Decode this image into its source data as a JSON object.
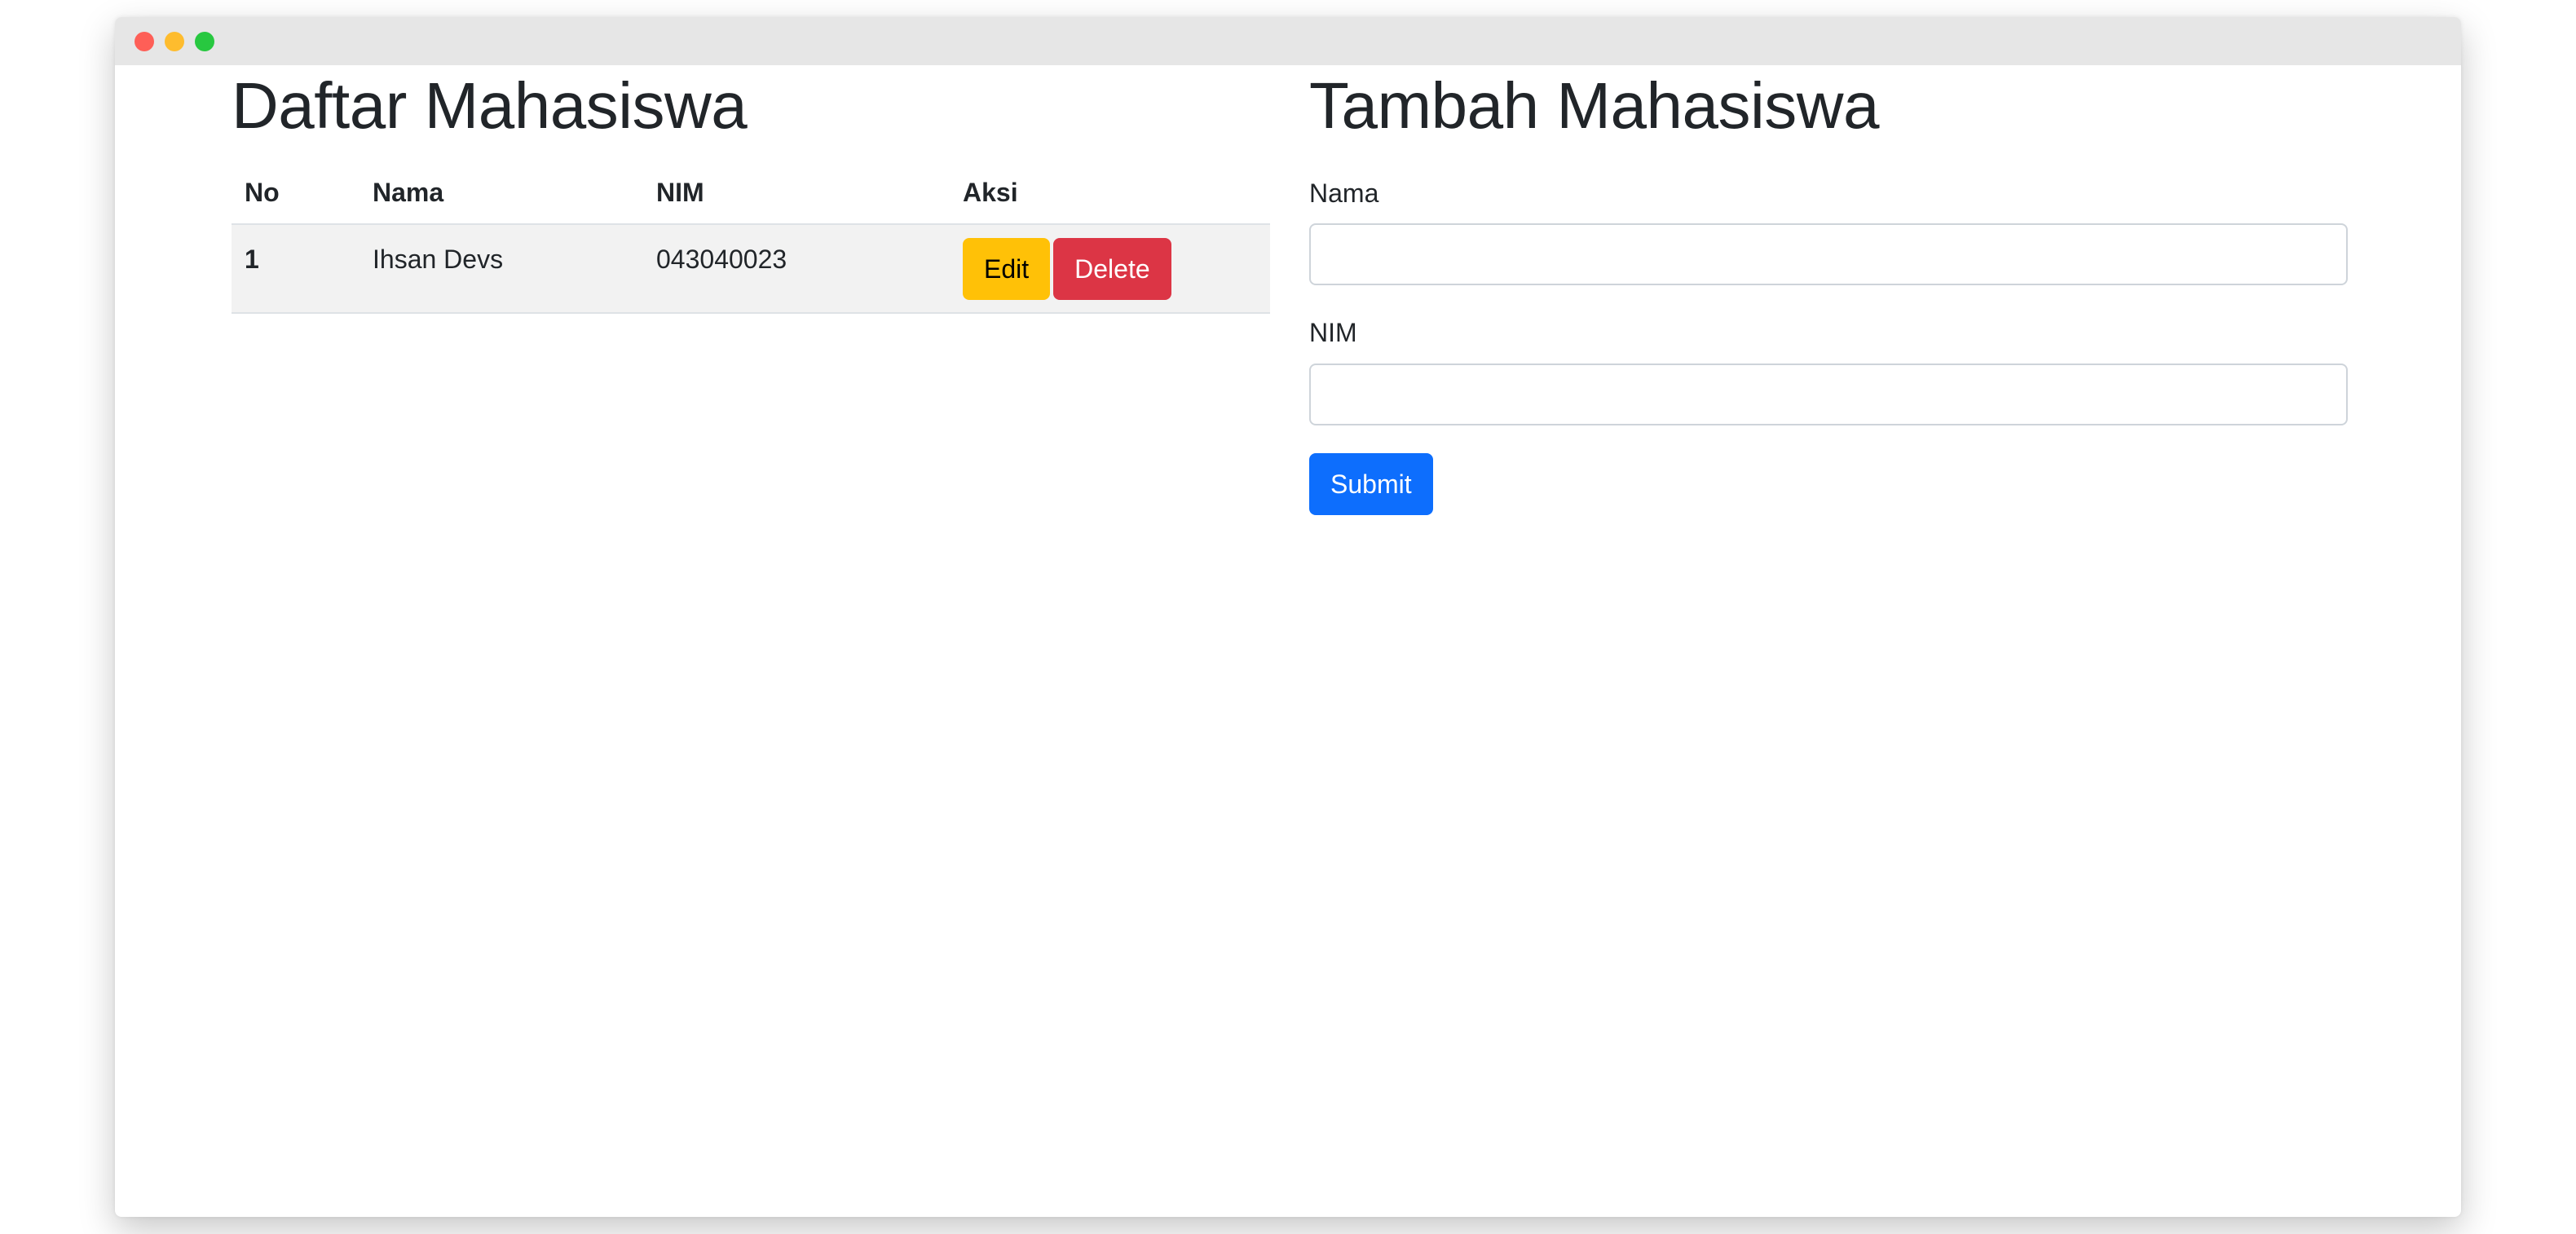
{
  "daftar": {
    "title": "Daftar Mahasiswa",
    "columns": [
      "No",
      "Nama",
      "NIM",
      "Aksi"
    ],
    "rows": [
      {
        "no": "1",
        "nama": "Ihsan Devs",
        "nim": "043040023",
        "edit_label": "Edit",
        "delete_label": "Delete"
      }
    ]
  },
  "tambah": {
    "title": "Tambah Mahasiswa",
    "nama_label": "Nama",
    "nama_value": "",
    "nim_label": "NIM",
    "nim_value": "",
    "submit_label": "Submit"
  },
  "colors": {
    "edit": "#ffc107",
    "delete": "#dc3545",
    "submit": "#0d6efd"
  }
}
